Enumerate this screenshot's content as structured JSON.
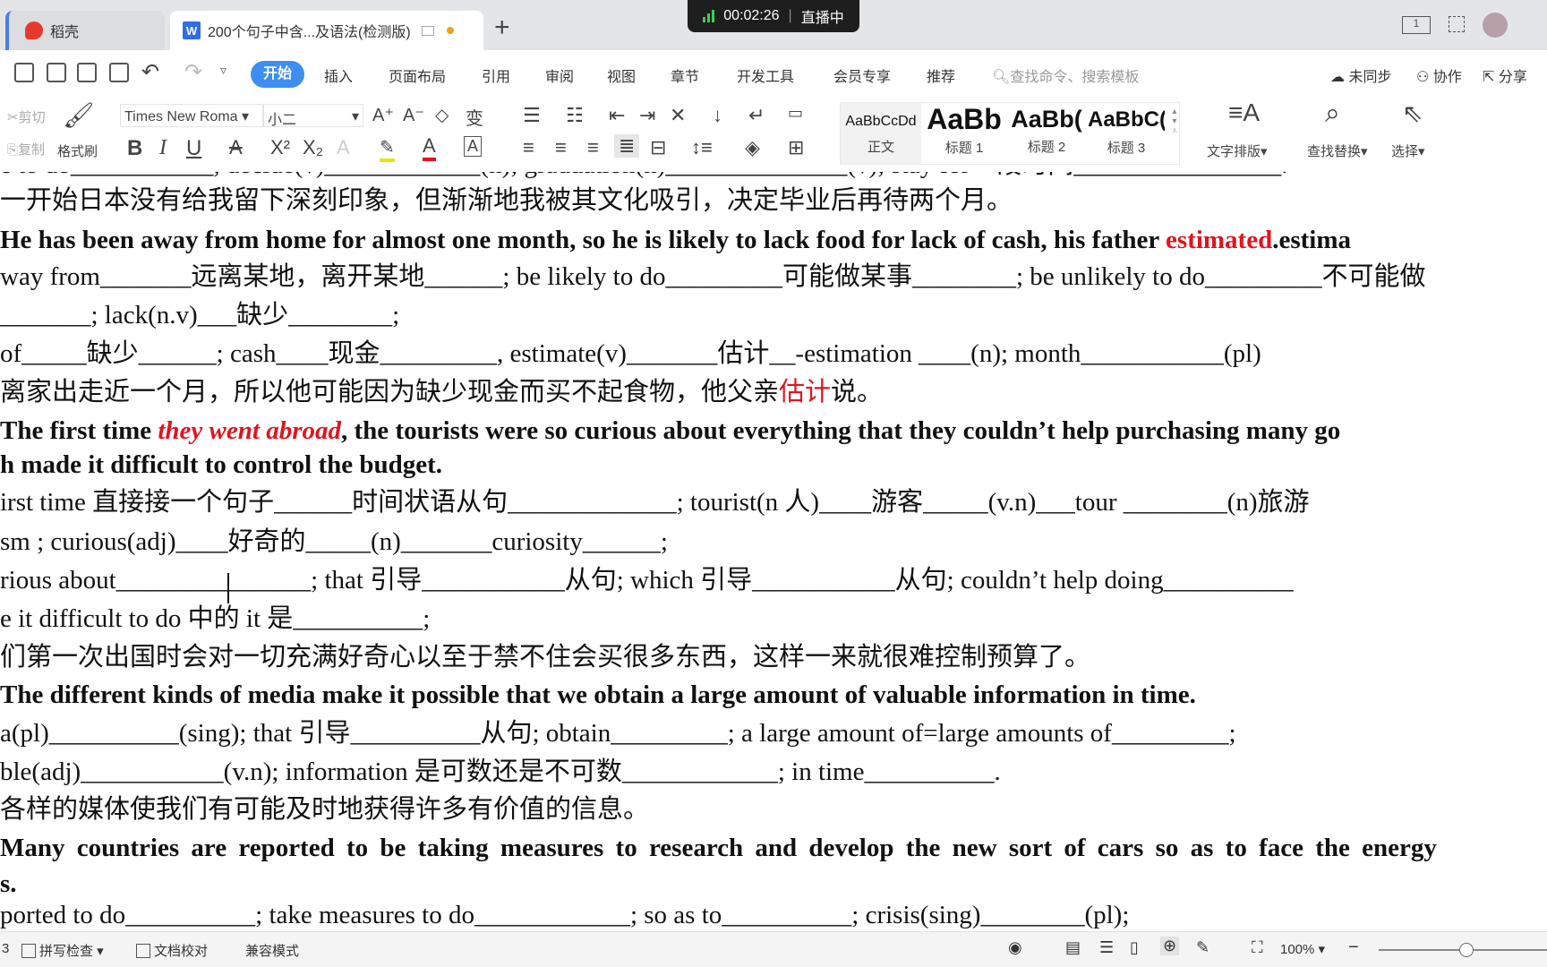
{
  "tabs": [
    {
      "label": "稻壳",
      "icon": "daoke-logo-icon"
    },
    {
      "label": "200个句子中含...及语法(检测版)",
      "icon": "wps-writer-icon",
      "modified": true
    }
  ],
  "live": {
    "time": "00:02:26",
    "status": "直播中",
    "signal_color": "#3ccf4e"
  },
  "menu": {
    "items": [
      "开始",
      "插入",
      "页面布局",
      "引用",
      "审阅",
      "视图",
      "章节",
      "开发工具",
      "会员专享",
      "推荐"
    ],
    "active": "开始",
    "search_placeholder": "查找命令、搜索模板",
    "sync": "未同步",
    "collab": "协作",
    "share": "分享"
  },
  "toolbar": {
    "cut": "剪切",
    "copy": "复制",
    "format_painter": "格式刷",
    "font": "Times New Roma",
    "size": "小二",
    "styles": [
      {
        "preview": "AaBbCcDd",
        "label": "正文"
      },
      {
        "preview": "AaBb",
        "label": "标题 1"
      },
      {
        "preview": "AaBb(",
        "label": "标题 2"
      },
      {
        "preview": "AaBbC(",
        "label": "标题 3"
      }
    ],
    "text_layout": "文字排版",
    "find_replace": "查找替换",
    "select": "选择"
  },
  "colors": {
    "accent": "#3d8ef0",
    "highlight": "#e0141e"
  },
  "document": {
    "lines": [
      [
        {
          "t": "e to do___________, decide(v)____________(n); graduation(n)______________(v); stay for一段时间________________."
        }
      ],
      [
        {
          "t": "一开始日本没有给我留下深刻印象，但渐渐地我被其文化吸引，决定毕业后再待两个月。"
        }
      ],
      [
        {
          "t": "He has been away from home for almost one month, so he is likely to lack food for lack of cash, his father ",
          "s": "b"
        },
        {
          "t": "estimated",
          "s": "b r"
        },
        {
          "t": ".estima",
          "s": "b"
        }
      ],
      [
        {
          "t": "way from_______远离某地，离开某地______; be likely to do_________可能做某事________; be unlikely to do_________不可能做"
        }
      ],
      [
        {
          "t": "_______; lack(n.v)___缺少________;"
        }
      ],
      [
        {
          "t": "of_____缺少______; cash____现金_________, estimate(v)_______估计__-estimation ____(n); month___________(pl)"
        }
      ],
      [
        {
          "t": "离家出走近一个月，所以他可能因为缺少现金而买不起食物，他父亲"
        },
        {
          "t": "估计",
          "s": "r"
        },
        {
          "t": "说。"
        }
      ],
      [
        {
          "t": "The first time ",
          "s": "b"
        },
        {
          "t": "they went abroad",
          "s": "b r i"
        },
        {
          "t": ", the tourists were so curious about everything that they couldn’t help purchasing many go",
          "s": "b"
        }
      ],
      [
        {
          "t": "h made it difficult to control the budget.",
          "s": "b"
        }
      ],
      [
        {
          "t": "irst time 直接接一个句子______时间状语从句_____________; tourist(n 人)____游客_____(v.n)___tour ________(n)旅游"
        }
      ],
      [
        {
          "t": "sm ; curious(adj)____好奇的_____(n)_______curiosity______;"
        }
      ],
      [
        {
          "t": "rious about_______________; that 引导___________从句; which 引导___________从句; couldn’t help doing__________"
        }
      ],
      [
        {
          "t": "e it difficult to do 中的 it 是__________;"
        }
      ],
      [
        {
          "t": "们第一次出国时会对一切充满好奇心以至于禁不住会买很多东西，这样一来就很难控制预算了。"
        }
      ],
      [
        {
          "t": "The different kinds of media make it possible that we obtain a large amount of valuable information in time.",
          "s": "b"
        }
      ],
      [
        {
          "t": "a(pl)__________(sing); that 引导__________从句; obtain_________; a large amount of=large amounts of_________;"
        }
      ],
      [
        {
          "t": "ble(adj)___________(v.n); information 是可数还是不可数____________; in time__________."
        }
      ],
      [
        {
          "t": "各样的媒体使我们有可能及时地获得许多有价值的信息。"
        }
      ],
      [
        {
          "t": "Many countries are reported to be taking measures to research and develop the new sort of cars so as to face the energy",
          "s": "b wide"
        }
      ],
      [
        {
          "t": "s.",
          "s": "b"
        }
      ],
      [
        {
          "t": "ported to do__________; take measures to do____________; so as to__________; crisis(sing)________(pl);"
        }
      ]
    ]
  },
  "status": {
    "page": "3",
    "spell_check": "拼写检查",
    "proofread": "文档校对",
    "compat": "兼容模式",
    "zoom": "100%",
    "zoom_level_percent": 100
  }
}
